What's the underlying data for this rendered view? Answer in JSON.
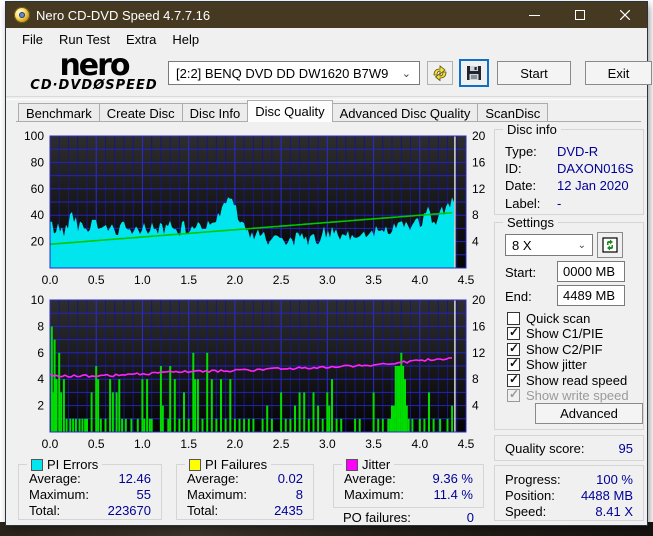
{
  "window": {
    "title": "Nero CD-DVD Speed 4.7.7.16",
    "caption_buttons": {
      "minimize": "—",
      "maximize": "□",
      "close": "✕"
    }
  },
  "menu": {
    "items": [
      "File",
      "Run Test",
      "Extra",
      "Help"
    ]
  },
  "logo": {
    "top": "nero",
    "bottom_left": "CD·DVD",
    "disc": "Ø",
    "bottom_right": "SPEED"
  },
  "toolbar": {
    "drive_selected": "[2:2]   BENQ DVD DD DW1620 B7W9",
    "eject_icon": "eject-refresh-icon",
    "save_icon": "save-floppy-icon",
    "start_label": "Start",
    "exit_label": "Exit"
  },
  "tabs": {
    "items": [
      "Benchmark",
      "Create Disc",
      "Disc Info",
      "Disc Quality",
      "Advanced Disc Quality",
      "ScanDisc"
    ],
    "active_index": 3
  },
  "disc_info": {
    "title": "Disc info",
    "rows": [
      {
        "label": "Type:",
        "value": "DVD-R"
      },
      {
        "label": "ID:",
        "value": "DAXON016S"
      },
      {
        "label": "Date:",
        "value": "12 Jan 2020"
      },
      {
        "label": "Label:",
        "value": "-"
      }
    ]
  },
  "settings": {
    "title": "Settings",
    "speed_selected": "8 X",
    "refresh_icon": "refresh-icon",
    "start_label": "Start:",
    "start_value": "0000 MB",
    "end_label": "End:",
    "end_value": "4489 MB",
    "checkboxes": [
      {
        "label": "Quick scan",
        "checked": false,
        "disabled": false
      },
      {
        "label": "Show C1/PIE",
        "checked": true,
        "disabled": false
      },
      {
        "label": "Show C2/PIF",
        "checked": true,
        "disabled": false
      },
      {
        "label": "Show jitter",
        "checked": true,
        "disabled": false
      },
      {
        "label": "Show read speed",
        "checked": true,
        "disabled": false
      },
      {
        "label": "Show write speed",
        "checked": true,
        "disabled": true
      }
    ],
    "advanced_label": "Advanced"
  },
  "quality": {
    "label": "Quality score:",
    "value": "95"
  },
  "progress": {
    "rows": [
      {
        "label": "Progress:",
        "value": "100 %"
      },
      {
        "label": "Position:",
        "value": "4488 MB"
      },
      {
        "label": "Speed:",
        "value": "8.41 X"
      }
    ]
  },
  "stats": {
    "pi_errors": {
      "title": "PI Errors",
      "color": "#00e5ee",
      "rows": [
        {
          "label": "Average:",
          "value": "12.46"
        },
        {
          "label": "Maximum:",
          "value": "55"
        },
        {
          "label": "Total:",
          "value": "223670"
        }
      ]
    },
    "pi_failures": {
      "title": "PI Failures",
      "color": "#ffff00",
      "rows": [
        {
          "label": "Average:",
          "value": "0.02"
        },
        {
          "label": "Maximum:",
          "value": "8"
        },
        {
          "label": "Total:",
          "value": "2435"
        }
      ]
    },
    "jitter": {
      "title": "Jitter",
      "color": "#ff00ff",
      "rows": [
        {
          "label": "Average:",
          "value": "9.36 %"
        },
        {
          "label": "Maximum:",
          "value": "11.4 %"
        }
      ]
    },
    "po_failures": {
      "label": "PO failures:",
      "value": "0"
    }
  },
  "chart_data": [
    {
      "type": "area",
      "name": "pi-errors-and-read-speed",
      "x_range": [
        0.0,
        4.5
      ],
      "x_ticks": [
        "0.0",
        "0.5",
        "1.0",
        "1.5",
        "2.0",
        "2.5",
        "3.0",
        "3.5",
        "4.0",
        "4.5"
      ],
      "left_axis": {
        "range": [
          0,
          100
        ],
        "ticks": [
          20,
          40,
          60,
          80,
          100
        ],
        "grid_step": 10
      },
      "right_axis": {
        "range": [
          0,
          20
        ],
        "ticks": [
          4,
          8,
          12,
          16,
          20
        ]
      },
      "grid": {
        "minor_x": 0.1,
        "major_x": 0.5
      },
      "end_marker_x": 4.38,
      "series": [
        {
          "name": "pi-errors",
          "type": "area",
          "color": "#00e5ee",
          "axis": "left",
          "step": 0.05,
          "noise": 5,
          "values": [
            33,
            28,
            30,
            26,
            35,
            40,
            32,
            30,
            28,
            33,
            38,
            25,
            27,
            30,
            26,
            28,
            30,
            27,
            25,
            28,
            30,
            28,
            32,
            27,
            30,
            28,
            31,
            26,
            28,
            30,
            27,
            30,
            33,
            30,
            32,
            38,
            35,
            40,
            48,
            55,
            45,
            38,
            28,
            24,
            22,
            25,
            23,
            20,
            22,
            21,
            23,
            20,
            22,
            21,
            23,
            22,
            20,
            22,
            21,
            23,
            24,
            26,
            24,
            22,
            23,
            22,
            24,
            23,
            25,
            24,
            26,
            28,
            26,
            30,
            28,
            32,
            30,
            33,
            30,
            34,
            32,
            36,
            40,
            34,
            38,
            42,
            45,
            52
          ]
        },
        {
          "name": "read-speed",
          "type": "line",
          "color": "#00c800",
          "axis": "right",
          "noise": 0,
          "points": [
            [
              0,
              3.6
            ],
            [
              4.38,
              8.41
            ]
          ]
        }
      ]
    },
    {
      "type": "bar",
      "name": "pi-failures-and-jitter",
      "x_range": [
        0.0,
        4.5
      ],
      "x_ticks": [
        "0.0",
        "0.5",
        "1.0",
        "1.5",
        "2.0",
        "2.5",
        "3.0",
        "3.5",
        "4.0",
        "4.5"
      ],
      "left_axis": {
        "range": [
          0,
          10
        ],
        "ticks": [
          2,
          4,
          6,
          8,
          10
        ],
        "grid_step": 1
      },
      "right_axis": {
        "range": [
          0,
          20
        ],
        "ticks": [
          4,
          8,
          12,
          16,
          20
        ]
      },
      "grid": {
        "minor_x": 0.1,
        "major_x": 0.5
      },
      "end_marker_x": 4.38,
      "series": [
        {
          "name": "pi-failures",
          "type": "bars",
          "color": "#00dd00",
          "axis": "left",
          "bars": [
            [
              0.02,
              8
            ],
            [
              0.03,
              3
            ],
            [
              0.05,
              7
            ],
            [
              0.07,
              4
            ],
            [
              0.1,
              6
            ],
            [
              0.12,
              3
            ],
            [
              0.15,
              4
            ],
            [
              0.18,
              1
            ],
            [
              0.22,
              1
            ],
            [
              0.25,
              1
            ],
            [
              0.28,
              1
            ],
            [
              0.32,
              1
            ],
            [
              0.35,
              1
            ],
            [
              0.38,
              1
            ],
            [
              0.4,
              1
            ],
            [
              0.45,
              3
            ],
            [
              0.5,
              5
            ],
            [
              0.52,
              4
            ],
            [
              0.55,
              1
            ],
            [
              0.6,
              1
            ],
            [
              0.65,
              4
            ],
            [
              0.68,
              3
            ],
            [
              0.72,
              3
            ],
            [
              0.75,
              4
            ],
            [
              0.78,
              1
            ],
            [
              0.82,
              1
            ],
            [
              0.88,
              1
            ],
            [
              0.95,
              1
            ],
            [
              1.0,
              4
            ],
            [
              1.02,
              1
            ],
            [
              1.05,
              4
            ],
            [
              1.08,
              1
            ],
            [
              1.1,
              1
            ],
            [
              1.2,
              5
            ],
            [
              1.22,
              2
            ],
            [
              1.28,
              1
            ],
            [
              1.3,
              5
            ],
            [
              1.35,
              4
            ],
            [
              1.4,
              1
            ],
            [
              1.45,
              3
            ],
            [
              1.5,
              1
            ],
            [
              1.55,
              6
            ],
            [
              1.57,
              4
            ],
            [
              1.6,
              4
            ],
            [
              1.65,
              1
            ],
            [
              1.7,
              6
            ],
            [
              1.75,
              4
            ],
            [
              1.8,
              1
            ],
            [
              1.85,
              4
            ],
            [
              1.9,
              1
            ],
            [
              1.95,
              4
            ],
            [
              2.0,
              1
            ],
            [
              2.05,
              1
            ],
            [
              2.1,
              1
            ],
            [
              2.15,
              1
            ],
            [
              2.2,
              1
            ],
            [
              2.3,
              1
            ],
            [
              2.35,
              2
            ],
            [
              2.4,
              1
            ],
            [
              2.5,
              3
            ],
            [
              2.55,
              1
            ],
            [
              2.6,
              1
            ],
            [
              2.65,
              2
            ],
            [
              2.7,
              3
            ],
            [
              2.75,
              3
            ],
            [
              2.8,
              1
            ],
            [
              2.85,
              3
            ],
            [
              2.9,
              2
            ],
            [
              2.95,
              1
            ],
            [
              3.0,
              3
            ],
            [
              3.02,
              2
            ],
            [
              3.05,
              4
            ],
            [
              3.1,
              1
            ],
            [
              3.15,
              1
            ],
            [
              3.3,
              1
            ],
            [
              3.35,
              1
            ],
            [
              3.5,
              3
            ],
            [
              3.55,
              1
            ],
            [
              3.6,
              1
            ],
            [
              3.66,
              1
            ],
            [
              3.68,
              1
            ],
            [
              3.7,
              2
            ],
            [
              3.72,
              2
            ],
            [
              3.74,
              5
            ],
            [
              3.76,
              5
            ],
            [
              3.78,
              5
            ],
            [
              3.8,
              6
            ],
            [
              3.82,
              5
            ],
            [
              3.84,
              4
            ],
            [
              3.86,
              2
            ],
            [
              3.88,
              1
            ],
            [
              3.92,
              1
            ],
            [
              4.0,
              1
            ],
            [
              4.05,
              1
            ],
            [
              4.1,
              3
            ],
            [
              4.15,
              1
            ],
            [
              4.22,
              1
            ],
            [
              4.3,
              1
            ],
            [
              4.35,
              2
            ]
          ]
        },
        {
          "name": "jitter",
          "type": "line",
          "color": "#ff22ff",
          "axis": "right",
          "noise": 0.18,
          "points": [
            [
              0,
              8.6
            ],
            [
              0.25,
              8.5
            ],
            [
              0.5,
              8.5
            ],
            [
              0.75,
              8.6
            ],
            [
              1.0,
              8.8
            ],
            [
              1.25,
              9.0
            ],
            [
              1.5,
              9.2
            ],
            [
              1.75,
              9.2
            ],
            [
              2.0,
              9.3
            ],
            [
              2.25,
              9.4
            ],
            [
              2.5,
              9.6
            ],
            [
              2.75,
              9.7
            ],
            [
              3.0,
              9.8
            ],
            [
              3.25,
              10.0
            ],
            [
              3.5,
              10.2
            ],
            [
              3.75,
              10.5
            ],
            [
              4.0,
              10.8
            ],
            [
              4.25,
              11.1
            ],
            [
              4.38,
              11.2
            ]
          ]
        }
      ]
    }
  ]
}
